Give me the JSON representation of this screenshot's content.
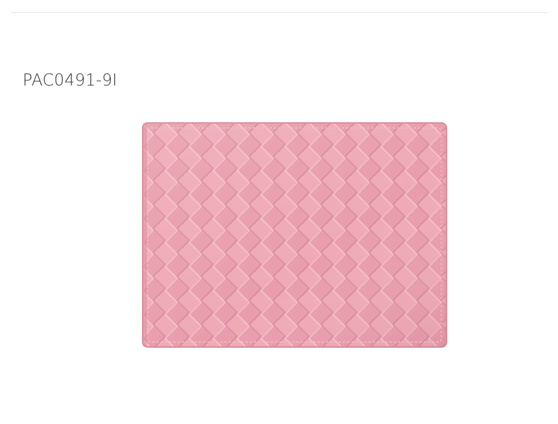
{
  "product": {
    "code": "PAC0491-9I",
    "image_name": "pink-woven-leather-bifold-wallet",
    "colors": {
      "leather": "#eda5b2",
      "leather_shadow": "#c8788a",
      "leather_highlight": "#f6c4cd",
      "background": "#ffffff",
      "divider": "#e6e6e6",
      "code_text": "#333333"
    }
  }
}
